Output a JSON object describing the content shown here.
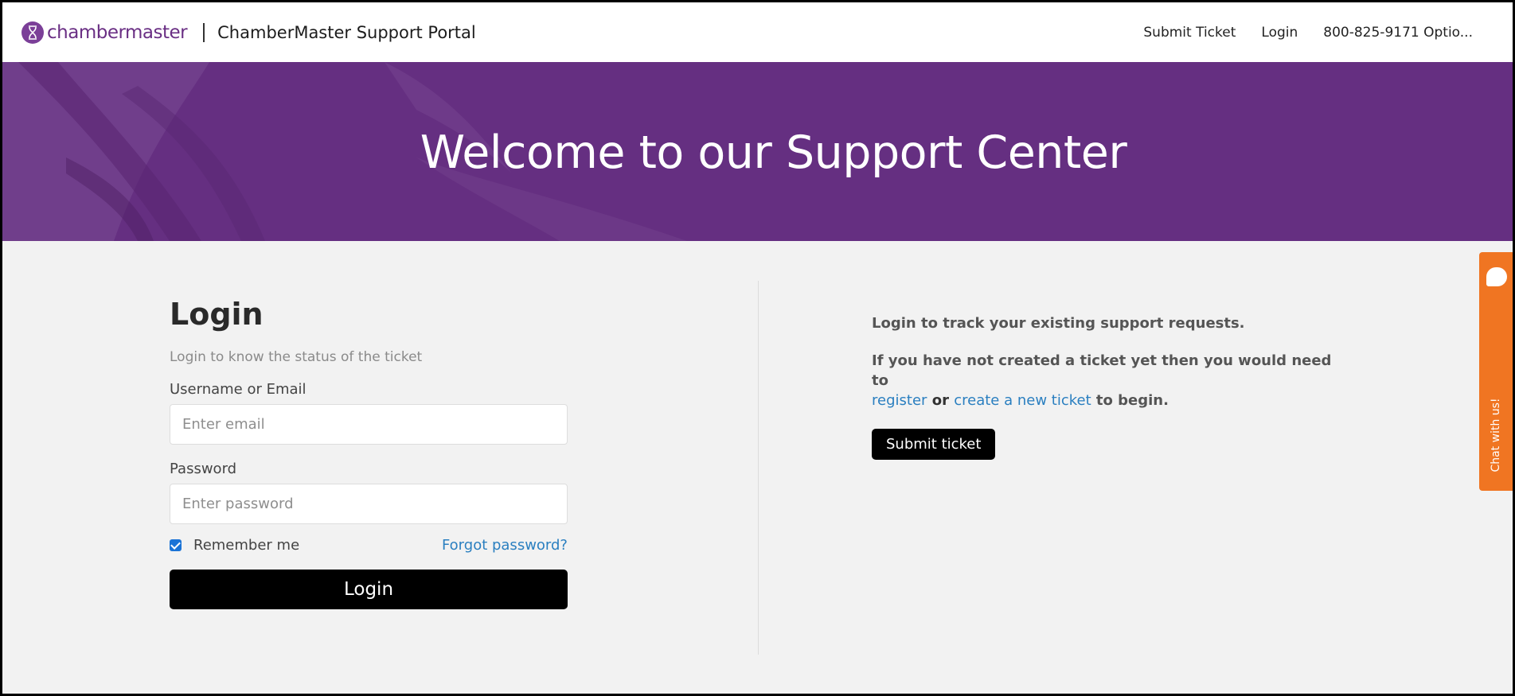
{
  "header": {
    "logo_text": "chambermaster",
    "portal_title": "ChamberMaster Support Portal",
    "nav": [
      {
        "label": "Submit Ticket"
      },
      {
        "label": "Login"
      },
      {
        "label": "800-825-9171 Optio..."
      }
    ]
  },
  "hero": {
    "title": "Welcome to our Support Center",
    "background_color": "#652f81"
  },
  "login": {
    "heading": "Login",
    "subtitle": "Login to know the status of the ticket",
    "username_label": "Username or Email",
    "username_placeholder": "Enter email",
    "username_value": "",
    "password_label": "Password",
    "password_placeholder": "Enter password",
    "password_value": "",
    "remember_label": "Remember me",
    "remember_checked": true,
    "forgot_label": "Forgot password?",
    "button_label": "Login"
  },
  "info": {
    "line1": "Login to track your existing support requests.",
    "line2_prefix": "If you have not created a ticket yet then you would need to",
    "register_link": "register",
    "or_text": "or",
    "new_ticket_link": "create a new ticket",
    "suffix": "to begin.",
    "submit_button": "Submit ticket"
  },
  "chat": {
    "label": "Chat with us!",
    "color": "#f07522"
  },
  "colors": {
    "link": "#2a7fc0",
    "brand_purple": "#652f81",
    "button": "#000000"
  }
}
